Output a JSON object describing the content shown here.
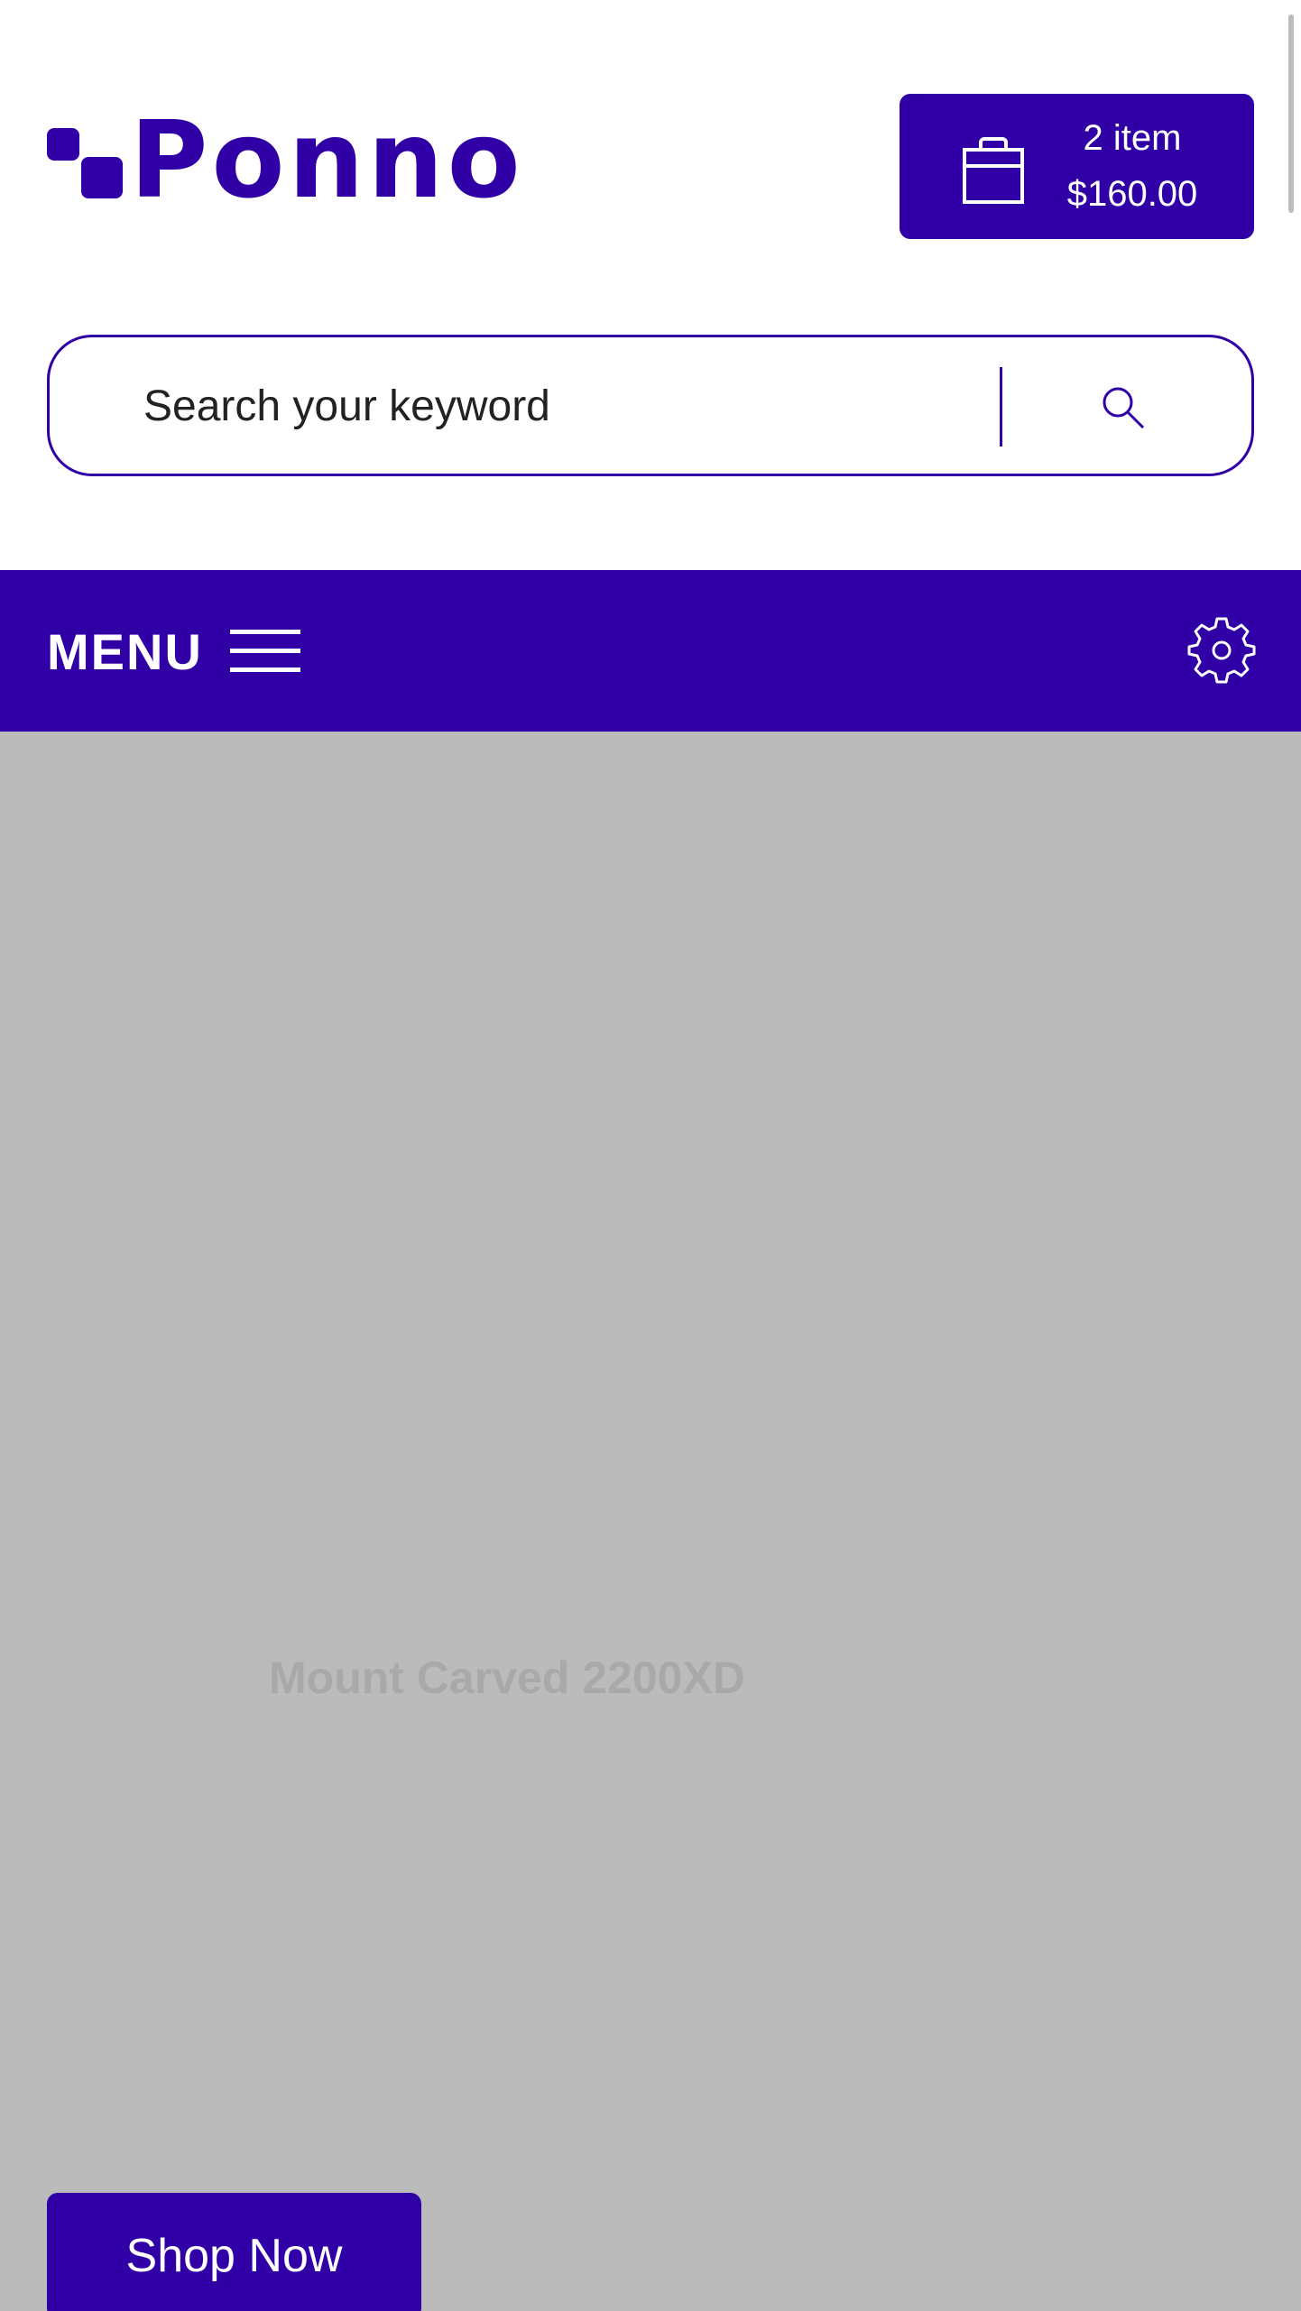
{
  "header": {
    "logo_text": "Ponno",
    "cart": {
      "items_label": "2 item",
      "total": "$160.00"
    }
  },
  "search": {
    "placeholder": "Search your keyword"
  },
  "nav": {
    "menu_label": "MENU"
  },
  "hero": {
    "title": "Mount Carved 2200XD",
    "cta_label": "Shop Now"
  },
  "colors": {
    "brand": "#3000a6",
    "hero_background": "#bbbbbb",
    "hero_title": "#a9a9a9"
  },
  "icons": [
    "logo-icon",
    "shopping-bag-icon",
    "search-icon",
    "hamburger-icon",
    "gear-icon"
  ]
}
